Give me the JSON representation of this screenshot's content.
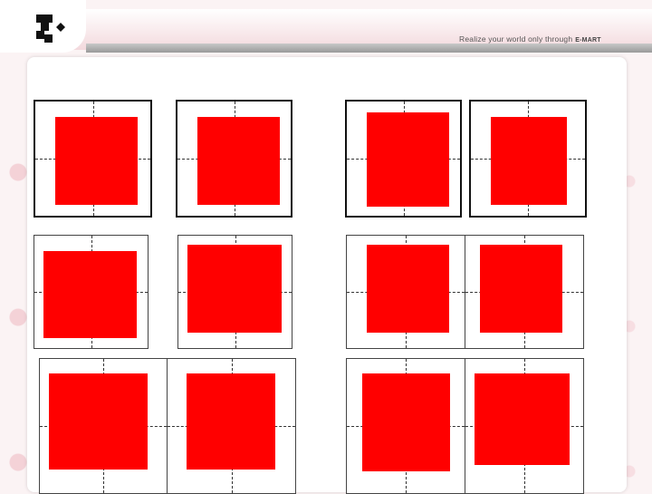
{
  "header": {
    "tagline": "Realize your world only through",
    "brand": "E-MART",
    "logo_icon": "emart-logo-icon"
  },
  "colors": {
    "square": "#ff0000",
    "background": "#fbf3f4"
  },
  "rows": [
    {
      "name": "row-1",
      "grid_style": "thick",
      "squares": 4
    },
    {
      "name": "row-2",
      "grid_style": "thin",
      "squares": 4
    },
    {
      "name": "row-3",
      "grid_style": "thin",
      "squares": 4
    }
  ]
}
